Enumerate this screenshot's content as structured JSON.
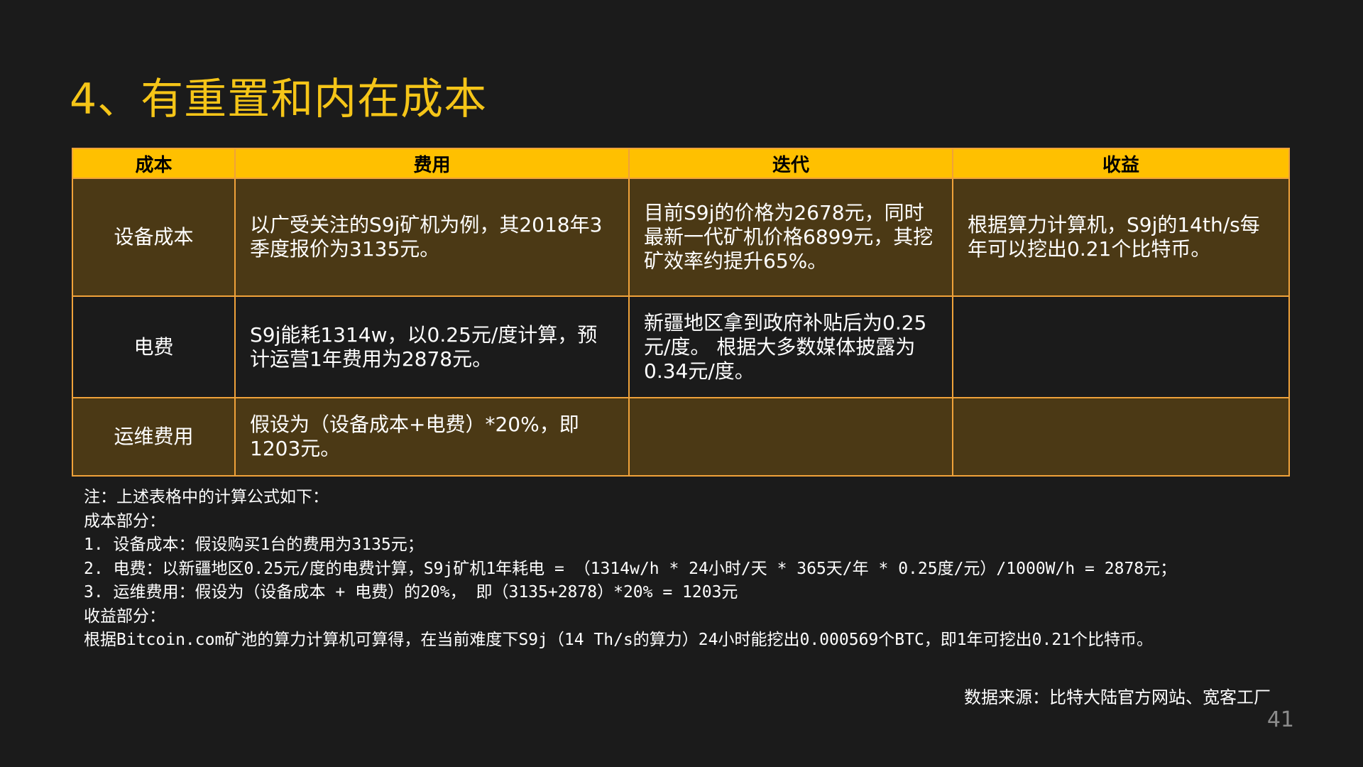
{
  "title": "4、有重置和内在成本",
  "table": {
    "headers": [
      "成本",
      "费用",
      "迭代",
      "收益"
    ],
    "rows": [
      {
        "label": "设备成本",
        "fee": "以广受关注的S9j矿机为例，其2018年3季度报价为3135元。",
        "iteration": "目前S9j的价格为2678元，同时最新一代矿机价格6899元，其挖矿效率约提升65%。",
        "revenue": "根据算力计算机，S9j的14th/s每年可以挖出0.21个比特币。"
      },
      {
        "label": "电费",
        "fee": "S9j能耗1314w，以0.25元/度计算，预计运营1年费用为2878元。",
        "iteration": "新疆地区拿到政府补贴后为0.25元/度。 根据大多数媒体披露为0.34元/度。",
        "revenue": ""
      },
      {
        "label": "运维费用",
        "fee": "假设为（设备成本+电费）*20%，即1203元。",
        "iteration": "",
        "revenue": ""
      }
    ]
  },
  "notes": [
    "注：上述表格中的计算公式如下：",
    "成本部分：",
    "1.  设备成本：假设购买1台的费用为3135元；",
    "2.  电费：以新疆地区0.25元/度的电费计算，S9j矿机1年耗电 = （1314w/h * 24小时/天 * 365天/年 * 0.25度/元）/1000W/h = 2878元；",
    "3.  运维费用：假设为（设备成本 + 电费）的20%， 即（3135+2878）*20% = 1203元",
    "收益部分：",
    "根据Bitcoin.com矿池的算力计算机可算得，在当前难度下S9j（14 Th/s的算力）24小时能挖出0.000569个BTC，即1年可挖出0.21个比特币。"
  ],
  "source": "数据来源：比特大陆官方网站、宽客工厂",
  "page_number": "41",
  "colors": {
    "background": "#1b1b1b",
    "title": "#f5c518",
    "header": "#ffc000",
    "row_brown": "#4b3915",
    "border": "#f0a23a"
  }
}
